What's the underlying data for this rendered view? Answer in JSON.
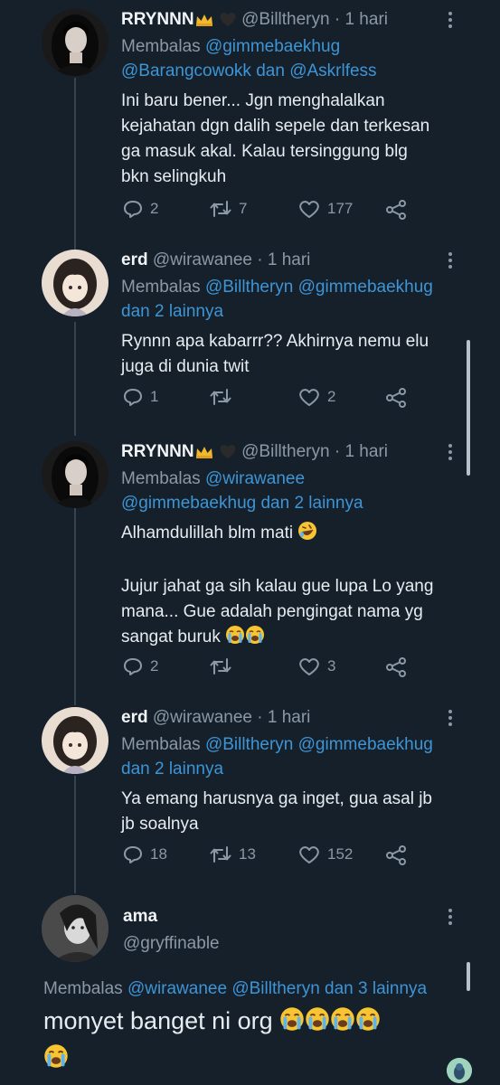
{
  "tweets": [
    {
      "name": "RRYNNN",
      "handle": "@Billtheryn",
      "time": "· 1 hari",
      "replying_prefix": "Membalas",
      "reply_line1": "@gimmebaekhug",
      "reply_line2_a": "@Barangcowokk",
      "reply_line2_b": "dan",
      "reply_line2_c": "@Askrlfess",
      "text": [
        "Ini baru bener... Jgn menghalalkan",
        "kejahatan dgn dalih sepele dan terkesan",
        "ga masuk akal. Kalau tersinggung blg",
        "bkn selingkuh"
      ],
      "replies": "2",
      "retweets": "7",
      "likes": "177"
    },
    {
      "name": "erd",
      "handle": "@wirawanee",
      "time": "· 1 hari",
      "replying_prefix": "Membalas",
      "reply_line1": "@Billtheryn @gimmebaekhug",
      "reply_line2": "dan 2 lainnya",
      "text": [
        "Rynnn apa kabarrr?? Akhirnya nemu elu",
        "juga di dunia twit"
      ],
      "replies": "1",
      "retweets": "",
      "likes": "2"
    },
    {
      "name": "RRYNNN",
      "handle": "@Billtheryn",
      "time": "· 1 hari",
      "replying_prefix": "Membalas",
      "reply_line1": "@wirawanee",
      "reply_line2": "@gimmebaekhug dan 2 lainnya",
      "text": [
        "Alhamdulillah blm mati",
        "",
        "Jujur jahat ga sih kalau gue lupa Lo yang",
        "mana... Gue adalah pengingat nama yg",
        "sangat buruk"
      ],
      "replies": "2",
      "retweets": "",
      "likes": "3"
    },
    {
      "name": "erd",
      "handle": "@wirawanee",
      "time": "· 1 hari",
      "replying_prefix": "Membalas",
      "reply_line1": "@Billtheryn @gimmebaekhug",
      "reply_line2": "dan 2 lainnya",
      "text": [
        "Ya emang harusnya ga inget, gua asal jb",
        "jb soalnya"
      ],
      "replies": "18",
      "retweets": "13",
      "likes": "152"
    }
  ],
  "main_tweet": {
    "name": "ama",
    "handle": "@gryffinable",
    "replying_prefix": "Membalas",
    "reply_mentions": "@wirawanee @Billtheryn dan 3 lainnya",
    "text": "monyet banget ni org"
  },
  "colors": {
    "background": "#16202b",
    "link": "#3d95d6",
    "muted": "#8b98a5",
    "text": "#e7ecf0"
  },
  "icons": [
    "reply-icon",
    "retweet-icon",
    "like-icon",
    "share-icon",
    "more-icon",
    "crown-emoji",
    "black-heart-emoji",
    "rofl-emoji",
    "loudly-crying-emoji"
  ]
}
